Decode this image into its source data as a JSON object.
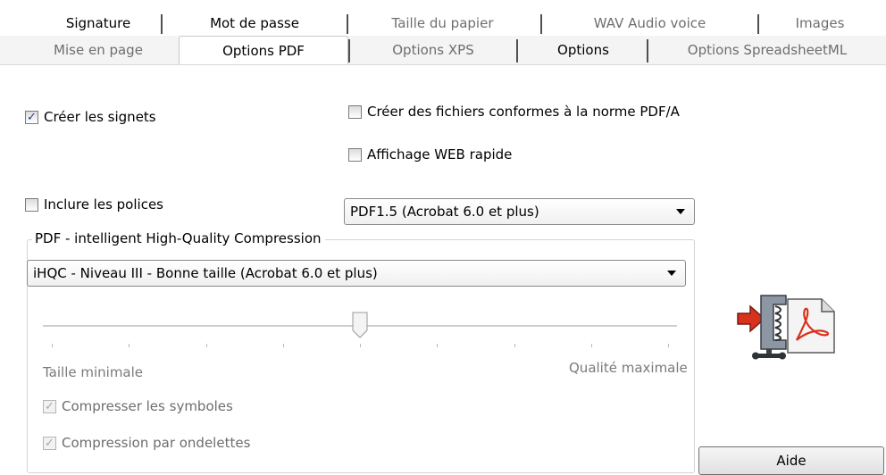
{
  "tabs_row1": [
    {
      "label": "Signature",
      "dim": false
    },
    {
      "label": "Mot de passe",
      "dim": false
    },
    {
      "label": "Taille du papier",
      "dim": true
    },
    {
      "label": "WAV Audio voice",
      "dim": true
    },
    {
      "label": "Images",
      "dim": true
    }
  ],
  "tabs_row2": [
    {
      "label": "Mise en page",
      "dim": true
    },
    {
      "label": "Options PDF",
      "active": true
    },
    {
      "label": "Options XPS",
      "dim": true
    },
    {
      "label": "Options",
      "dim": false
    },
    {
      "label": "Options SpreadsheetML",
      "dim": true
    }
  ],
  "options": {
    "create_bookmarks": {
      "label": "Créer les signets",
      "checked": true
    },
    "pdfa": {
      "label": "Créer des fichiers conformes à la norme PDF/A",
      "checked": false
    },
    "fast_web": {
      "label": "Affichage WEB rapide",
      "checked": false
    },
    "embed_fonts": {
      "label": "Inclure les polices",
      "checked": false
    }
  },
  "pdf_version": {
    "value": "PDF1.5 (Acrobat 6.0 et plus)"
  },
  "compression": {
    "group_label": "PDF - intelligent High-Quality Compression",
    "level": "iHQC - Niveau III - Bonne taille (Acrobat 6.0 et plus)",
    "slider_fraction": 0.5,
    "min_label": "Taille minimale",
    "max_label": "Qualité maximale",
    "compress_symbols": {
      "label": "Compresser les symboles",
      "checked": true,
      "disabled": true
    },
    "wavelet": {
      "label": "Compression par ondelettes",
      "checked": true,
      "disabled": true
    }
  },
  "help_button": "Aide",
  "icons": {
    "compress": "pdf-compress-icon"
  }
}
